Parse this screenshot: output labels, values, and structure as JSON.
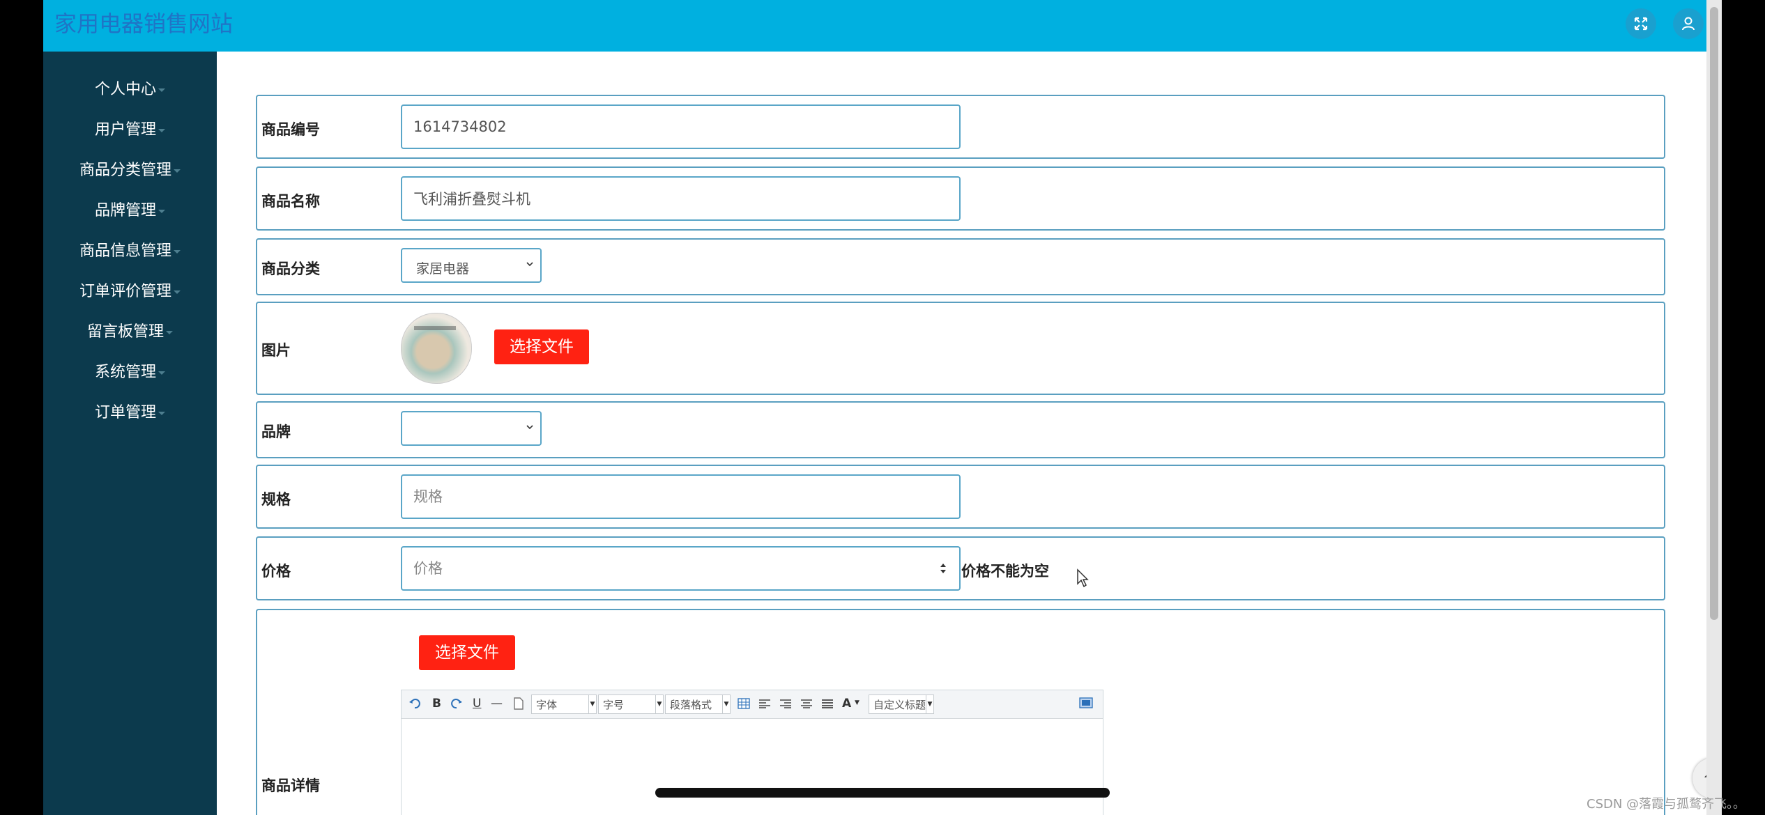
{
  "header": {
    "site_title": "家用电器销售网站",
    "fullscreen_icon": "fullscreen-icon",
    "user_icon": "user-icon"
  },
  "sidebar": {
    "items": [
      {
        "label": "个人中心"
      },
      {
        "label": "用户管理"
      },
      {
        "label": "商品分类管理"
      },
      {
        "label": "品牌管理"
      },
      {
        "label": "商品信息管理"
      },
      {
        "label": "订单评价管理"
      },
      {
        "label": "留言板管理"
      },
      {
        "label": "系统管理"
      },
      {
        "label": "订单管理"
      }
    ]
  },
  "form": {
    "product_id": {
      "label": "商品编号",
      "value": "1614734802"
    },
    "product_name": {
      "label": "商品名称",
      "value": "飞利浦折叠熨斗机"
    },
    "category": {
      "label": "商品分类",
      "value": "家居电器"
    },
    "image": {
      "label": "图片",
      "button": "选择文件"
    },
    "brand": {
      "label": "品牌",
      "value": ""
    },
    "spec": {
      "label": "规格",
      "placeholder": "规格"
    },
    "price": {
      "label": "价格",
      "placeholder": "价格",
      "error": "价格不能为空"
    },
    "details": {
      "label": "商品详情",
      "button": "选择文件",
      "toolbar": {
        "bold": "B",
        "underline": "U",
        "hr": "—",
        "font": "字体",
        "size": "字号",
        "paragraph": "段落格式",
        "font_color": "A",
        "custom_title": "自定义标题"
      }
    }
  },
  "watermark": "CSDN @落霞与孤鹜齐飞。。",
  "colors": {
    "topbar": "#00b0e0",
    "sidebar": "#0c3a4d",
    "accent_red": "#ff2212",
    "input_border": "#5aa6c8"
  }
}
